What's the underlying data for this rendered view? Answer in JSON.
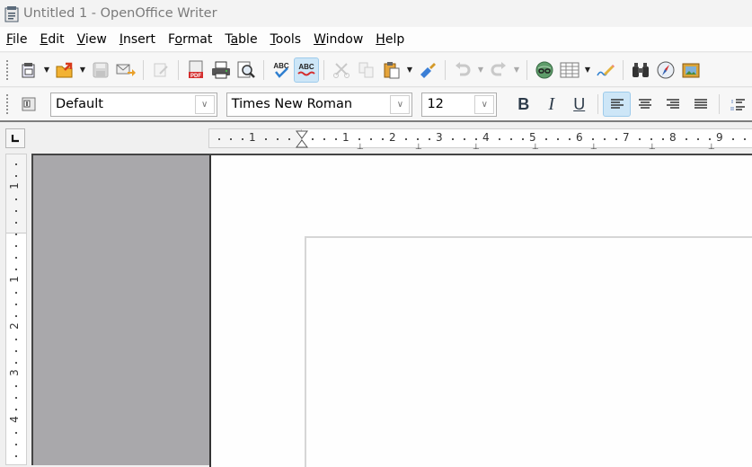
{
  "window": {
    "title": "Untitled 1 - OpenOffice Writer",
    "app_icon": "writer-document-icon"
  },
  "menubar": {
    "items": [
      {
        "label": "File",
        "mnemonic": "F"
      },
      {
        "label": "Edit",
        "mnemonic": "E"
      },
      {
        "label": "View",
        "mnemonic": "V"
      },
      {
        "label": "Insert",
        "mnemonic": "I"
      },
      {
        "label": "Format",
        "mnemonic": "o"
      },
      {
        "label": "Table",
        "mnemonic": "a"
      },
      {
        "label": "Tools",
        "mnemonic": "T"
      },
      {
        "label": "Window",
        "mnemonic": "W"
      },
      {
        "label": "Help",
        "mnemonic": "H"
      }
    ]
  },
  "standard_toolbar": {
    "buttons": [
      {
        "name": "new-icon",
        "enabled": true,
        "dropdown": true
      },
      {
        "name": "open-icon",
        "enabled": true,
        "dropdown": true
      },
      {
        "name": "save-icon",
        "enabled": false
      },
      {
        "name": "email-document-icon",
        "enabled": true
      },
      {
        "name": "edit-file-icon",
        "enabled": false
      },
      {
        "name": "export-pdf-icon",
        "enabled": true
      },
      {
        "name": "print-icon",
        "enabled": true
      },
      {
        "name": "page-preview-icon",
        "enabled": true
      },
      {
        "name": "spellcheck-icon",
        "enabled": true
      },
      {
        "name": "autospellcheck-icon",
        "enabled": true,
        "active": true
      },
      {
        "name": "cut-icon",
        "enabled": false
      },
      {
        "name": "copy-icon",
        "enabled": false
      },
      {
        "name": "paste-icon",
        "enabled": true,
        "dropdown": true
      },
      {
        "name": "clone-formatting-icon",
        "enabled": true
      },
      {
        "name": "undo-icon",
        "enabled": false,
        "dropdown": true
      },
      {
        "name": "redo-icon",
        "enabled": false,
        "dropdown": true
      },
      {
        "name": "hyperlink-icon",
        "enabled": true
      },
      {
        "name": "table-icon",
        "enabled": true,
        "dropdown": true
      },
      {
        "name": "show-draw-functions-icon",
        "enabled": true
      },
      {
        "name": "find-replace-icon",
        "enabled": true
      },
      {
        "name": "navigator-icon",
        "enabled": true
      },
      {
        "name": "gallery-icon",
        "enabled": true
      }
    ]
  },
  "formatting_toolbar": {
    "paragraph_style": "Default",
    "font_name": "Times New Roman",
    "font_size": "12",
    "bold_label": "B",
    "italic_label": "I",
    "underline_label": "U",
    "alignment": "left"
  },
  "ruler": {
    "horizontal_labels": [
      "1",
      "1",
      "2",
      "3",
      "4",
      "5",
      "6",
      "7",
      "8",
      "9"
    ],
    "vertical_labels": [
      "1",
      "1",
      "2",
      "3",
      "4"
    ],
    "unit": "cm"
  },
  "colors": {
    "active_button_bg": "#cde6f7",
    "workspace_bg": "#a9a8ab",
    "page_bg": "#fefefe"
  }
}
